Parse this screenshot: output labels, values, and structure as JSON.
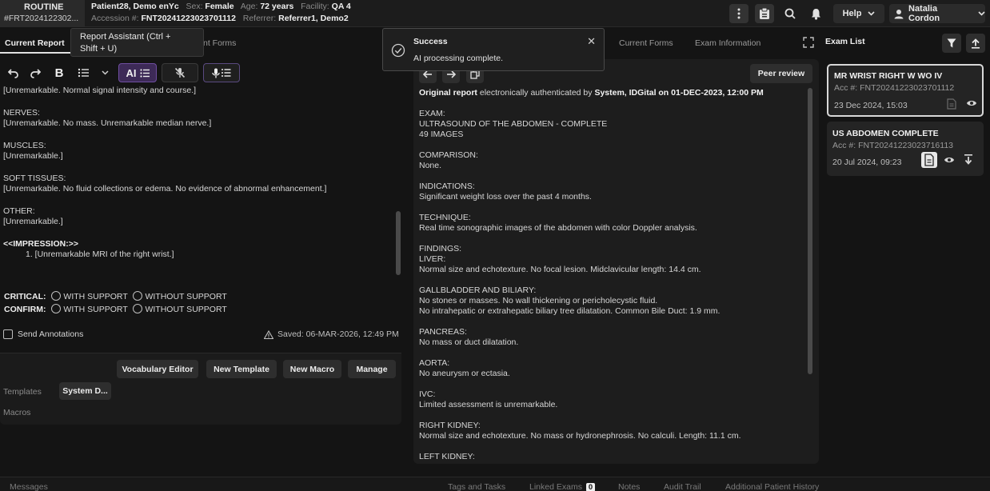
{
  "header": {
    "priority": "ROUTINE",
    "accession_short": "#FRT2024122302...",
    "patient_name": "Patient28, Demo enYc",
    "sex_label": "Sex:",
    "sex": "Female",
    "age_label": "Age:",
    "age": "72 years",
    "facility_label": "Facility:",
    "facility": "QA 4",
    "accession_label": "Accession #:",
    "accession": "FNT20241223023701112",
    "referrer_label": "Referrer:",
    "referrer": "Referrer1, Demo2",
    "help_label": "Help",
    "user_name": "Natalia Cordon",
    "icons": [
      "more-vert-icon",
      "clipboard-icon",
      "search-icon",
      "bell-icon",
      "chevron-down-icon",
      "user-icon"
    ]
  },
  "left_tabs": {
    "current_report": "Current Report",
    "forms_partial": "nt Forms"
  },
  "tooltip": {
    "line1": "Report Assistant (Ctrl +",
    "line2": "Shift + U)"
  },
  "toolbar": {
    "ai_label": "AI",
    "icons": [
      "undo-icon",
      "redo-icon",
      "bold-icon",
      "list-icon",
      "chevron-down-icon",
      "ai-list-icon",
      "mic-off-icon",
      "mic-list-icon"
    ]
  },
  "report": {
    "line0": "[Unremarkable. Normal signal intensity and course.]",
    "nerves_h": "NERVES:",
    "nerves_t": "[Unremarkable. No mass. Unremarkable median nerve.]",
    "muscles_h": "MUSCLES:",
    "muscles_t": "[Unremarkable.]",
    "soft_h": "SOFT TISSUES:",
    "soft_t": "[Unremarkable. No fluid collections or edema. No evidence of abnormal enhancement.]",
    "other_h": "OTHER:",
    "other_t": "[Unremarkable.]",
    "impression_h": "<<IMPRESSION:>>",
    "impression_t": "1. [Unremarkable MRI of the right wrist.]"
  },
  "critical": {
    "critical_label": "CRITICAL:",
    "confirm_label": "CONFIRM:",
    "with_support": "WITH SUPPORT",
    "without_support": "WITHOUT SUPPORT"
  },
  "annotations": {
    "send_label": "Send Annotations",
    "saved": "Saved: 06-MAR-2026, 12:49 PM"
  },
  "lower": {
    "vocabulary_editor": "Vocabulary Editor",
    "new_template": "New Template",
    "new_macro": "New Macro",
    "manage": "Manage",
    "templates_label": "Templates",
    "system_btn": "System D...",
    "macros_label": "Macros"
  },
  "middle_tabs": {
    "current_forms": "Current Forms",
    "exam_information": "Exam Information"
  },
  "toast": {
    "title": "Success",
    "message": "AI processing complete."
  },
  "original": {
    "peer_review": "Peer review",
    "auth_prefix": "Original report",
    "auth_mid": " electronically authenticated by ",
    "auth_bold": "System, IDGital on 01-DEC-2023, 12:00 PM",
    "exam_h": "EXAM:",
    "exam_t1": "ULTRASOUND OF THE ABDOMEN - COMPLETE",
    "exam_t2": "49 IMAGES",
    "comparison_h": "COMPARISON:",
    "comparison_t": "None.",
    "indications_h": "INDICATIONS:",
    "indications_t": "Significant weight loss over the past 4 months.",
    "technique_h": "TECHNIQUE:",
    "technique_t": "Real time sonographic images of the abdomen with color Doppler analysis.",
    "findings_h": "FINDINGS:",
    "liver_h": "LIVER:",
    "liver_t": "Normal size and echotexture. No focal lesion. Midclavicular length: 14.4 cm.",
    "gb_h": "GALLBLADDER AND BILIARY:",
    "gb_t1": "No stones or masses. No wall thickening or pericholecystic fluid.",
    "gb_t2": "No intrahepatic or extrahepatic biliary tree dilatation. Common Bile Duct: 1.9 mm.",
    "pancreas_h": "PANCREAS:",
    "pancreas_t": "No mass or duct dilatation.",
    "aorta_h": "AORTA:",
    "aorta_t": "No aneurysm or ectasia.",
    "ivc_h": "IVC:",
    "ivc_t": "Limited assessment is unremarkable.",
    "rk_h": "RIGHT KIDNEY:",
    "rk_t": "Normal size and echotexture. No mass or hydronephrosis. No calculi. Length: 11.1 cm.",
    "lk_h": "LEFT KIDNEY:"
  },
  "exam_list": {
    "title": "Exam List",
    "items": [
      {
        "title": "MR WRIST RIGHT W WO IV",
        "acc": "Acc #: FNT20241223023701112",
        "date": "23 Dec 2024, 15:03"
      },
      {
        "title": "US ABDOMEN COMPLETE",
        "acc": "Acc #: FNT20241223023716113",
        "date": "20 Jul 2024, 09:23"
      }
    ]
  },
  "bottom": {
    "messages": "Messages",
    "tags_tasks": "Tags and Tasks",
    "linked_exams": "Linked Exams",
    "linked_count": "0",
    "notes": "Notes",
    "audit_trail": "Audit Trail",
    "additional_history": "Additional Patient History"
  }
}
